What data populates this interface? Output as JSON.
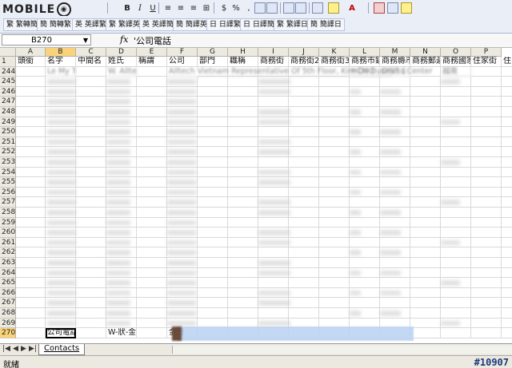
{
  "brand": {
    "logo_text": "MOBILE"
  },
  "toolbar1": {
    "bold": "B",
    "italic": "I",
    "underline": "U",
    "currency": "$",
    "percent": "%",
    "comma": ","
  },
  "toolbar2": {
    "chips": [
      "繁 繁轉簡",
      "簡 簡轉繁",
      "英 英譯繁",
      "繁 繁譯英",
      "英 英譯簡",
      "簡 簡譯英",
      "日 日譯繁",
      "日 日譯簡",
      "繁 繁譯日",
      "簡 簡譯日"
    ]
  },
  "formula_bar": {
    "name_box": "B270",
    "fx": "fx",
    "value": "'公司電話"
  },
  "columns": [
    "A",
    "B",
    "C",
    "D",
    "E",
    "F",
    "G",
    "H",
    "I",
    "J",
    "K",
    "L",
    "M",
    "N",
    "O",
    "P"
  ],
  "header_row": {
    "num": "1",
    "cells": [
      "頭銜",
      "名字",
      "中間名",
      "姓氏",
      "稱謂",
      "公司",
      "部門",
      "職稱",
      "商務街",
      "商務街2",
      "商務街3",
      "商務市鎮",
      "商務縣市",
      "商務郵遞",
      "商務國家",
      "住家街",
      "住"
    ]
  },
  "rows": [
    {
      "num": "244",
      "b": "Le My Thien",
      "d": "W. Alltech",
      "f": "Alltech Vietnam Representative Of 5th Floor, Kim Do Business Center",
      "l": "HCMC",
      "m": "DIST 1",
      "o": "越南"
    },
    {
      "num": "245"
    },
    {
      "num": "246"
    },
    {
      "num": "247"
    },
    {
      "num": "248"
    },
    {
      "num": "249"
    },
    {
      "num": "250"
    },
    {
      "num": "251"
    },
    {
      "num": "252"
    },
    {
      "num": "253"
    },
    {
      "num": "254"
    },
    {
      "num": "255"
    },
    {
      "num": "256"
    },
    {
      "num": "257"
    },
    {
      "num": "258"
    },
    {
      "num": "259"
    },
    {
      "num": "260"
    },
    {
      "num": "261"
    },
    {
      "num": "262"
    },
    {
      "num": "263"
    },
    {
      "num": "264"
    },
    {
      "num": "265"
    },
    {
      "num": "266"
    },
    {
      "num": "267"
    },
    {
      "num": "268"
    },
    {
      "num": "269"
    },
    {
      "num": "270",
      "b": "公司電話",
      "d": "W-狀-金達東",
      "f": "金達"
    }
  ],
  "sheet_tab": "Contacts",
  "status": {
    "text": "就緒",
    "tag": "#10907"
  }
}
